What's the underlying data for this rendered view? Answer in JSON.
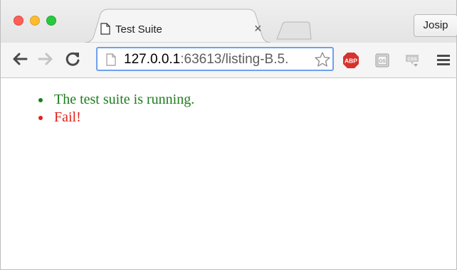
{
  "browser": {
    "tab_title": "Test Suite",
    "tab_close_glyph": "×",
    "profile_button_label": "Josip",
    "address": {
      "host": "127.0.0.1",
      "rest": ":63613/listing-B.5."
    },
    "extensions": [
      {
        "name": "adblock-plus-icon",
        "label": "ABP",
        "color": "#d9312b"
      },
      {
        "name": "os-extension-icon",
        "label": "OS",
        "color": "#9a9a9a"
      },
      {
        "name": "css-extension-icon",
        "label": "CSS",
        "color": "#a8a8a8"
      }
    ]
  },
  "page": {
    "results": [
      {
        "text": "The test suite is running.",
        "status": "pass",
        "color": "#1d7d1d"
      },
      {
        "text": "Fail!",
        "status": "fail",
        "color": "#e32119"
      }
    ]
  }
}
